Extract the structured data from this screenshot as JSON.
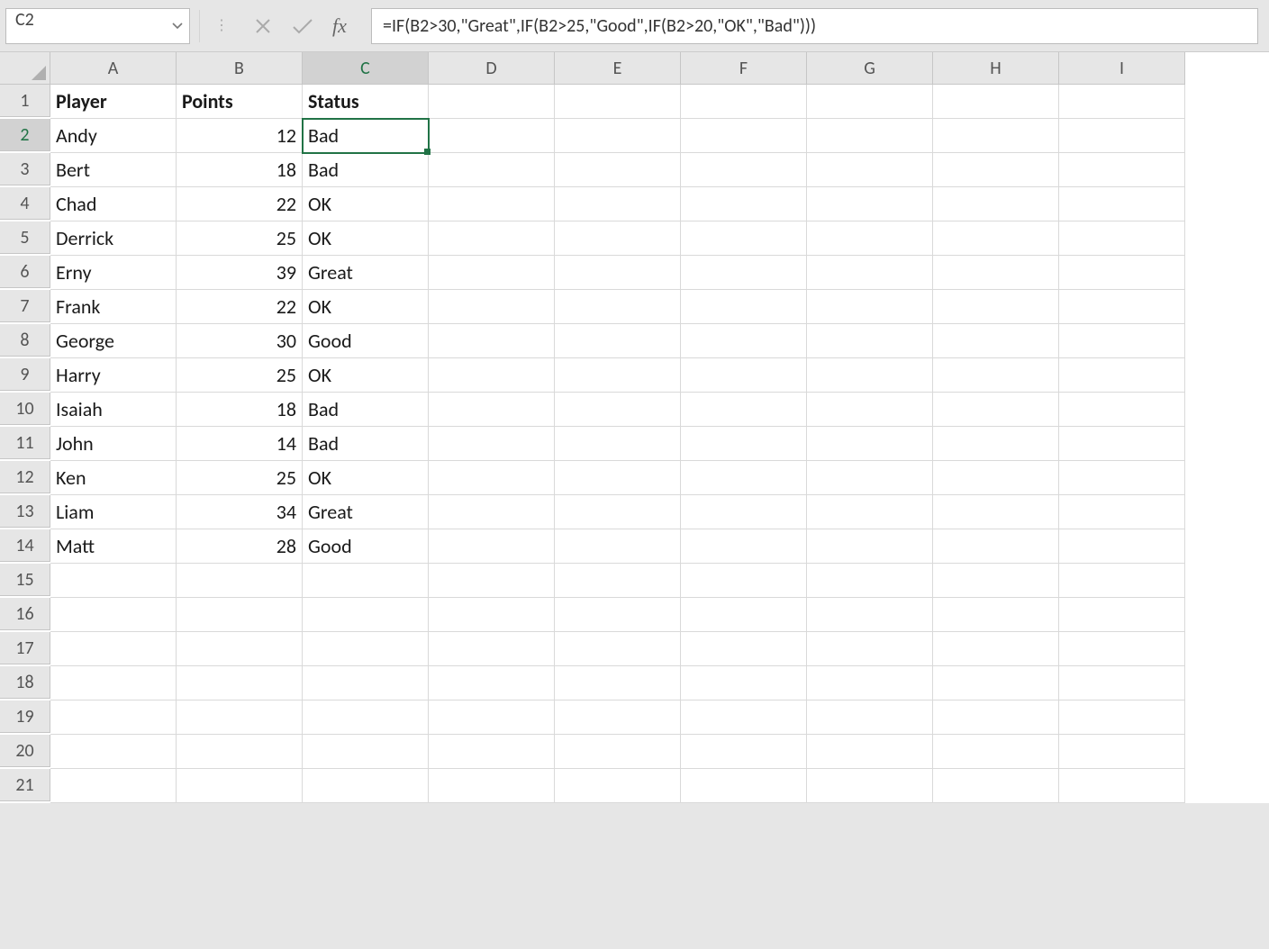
{
  "formula_bar": {
    "name_box": "C2",
    "fx_label": "fx",
    "formula": "=IF(B2>30,\"Great\",IF(B2>25,\"Good\",IF(B2>20,\"OK\",\"Bad\")))",
    "cancel_icon": "cancel-icon",
    "enter_icon": "enter-icon"
  },
  "columns": [
    "A",
    "B",
    "C",
    "D",
    "E",
    "F",
    "G",
    "H",
    "I"
  ],
  "visible_rows": 21,
  "selected_cell": {
    "col": "C",
    "row": 2
  },
  "headers": {
    "A": "Player",
    "B": "Points",
    "C": "Status"
  },
  "data_rows": [
    {
      "row": 2,
      "player": "Andy",
      "points": 12,
      "status": "Bad"
    },
    {
      "row": 3,
      "player": "Bert",
      "points": 18,
      "status": "Bad"
    },
    {
      "row": 4,
      "player": "Chad",
      "points": 22,
      "status": "OK"
    },
    {
      "row": 5,
      "player": "Derrick",
      "points": 25,
      "status": "OK"
    },
    {
      "row": 6,
      "player": "Erny",
      "points": 39,
      "status": "Great"
    },
    {
      "row": 7,
      "player": "Frank",
      "points": 22,
      "status": "OK"
    },
    {
      "row": 8,
      "player": "George",
      "points": 30,
      "status": "Good"
    },
    {
      "row": 9,
      "player": "Harry",
      "points": 25,
      "status": "OK"
    },
    {
      "row": 10,
      "player": "Isaiah",
      "points": 18,
      "status": "Bad"
    },
    {
      "row": 11,
      "player": "John",
      "points": 14,
      "status": "Bad"
    },
    {
      "row": 12,
      "player": "Ken",
      "points": 25,
      "status": "OK"
    },
    {
      "row": 13,
      "player": "Liam",
      "points": 34,
      "status": "Great"
    },
    {
      "row": 14,
      "player": "Matt",
      "points": 28,
      "status": "Good"
    }
  ]
}
